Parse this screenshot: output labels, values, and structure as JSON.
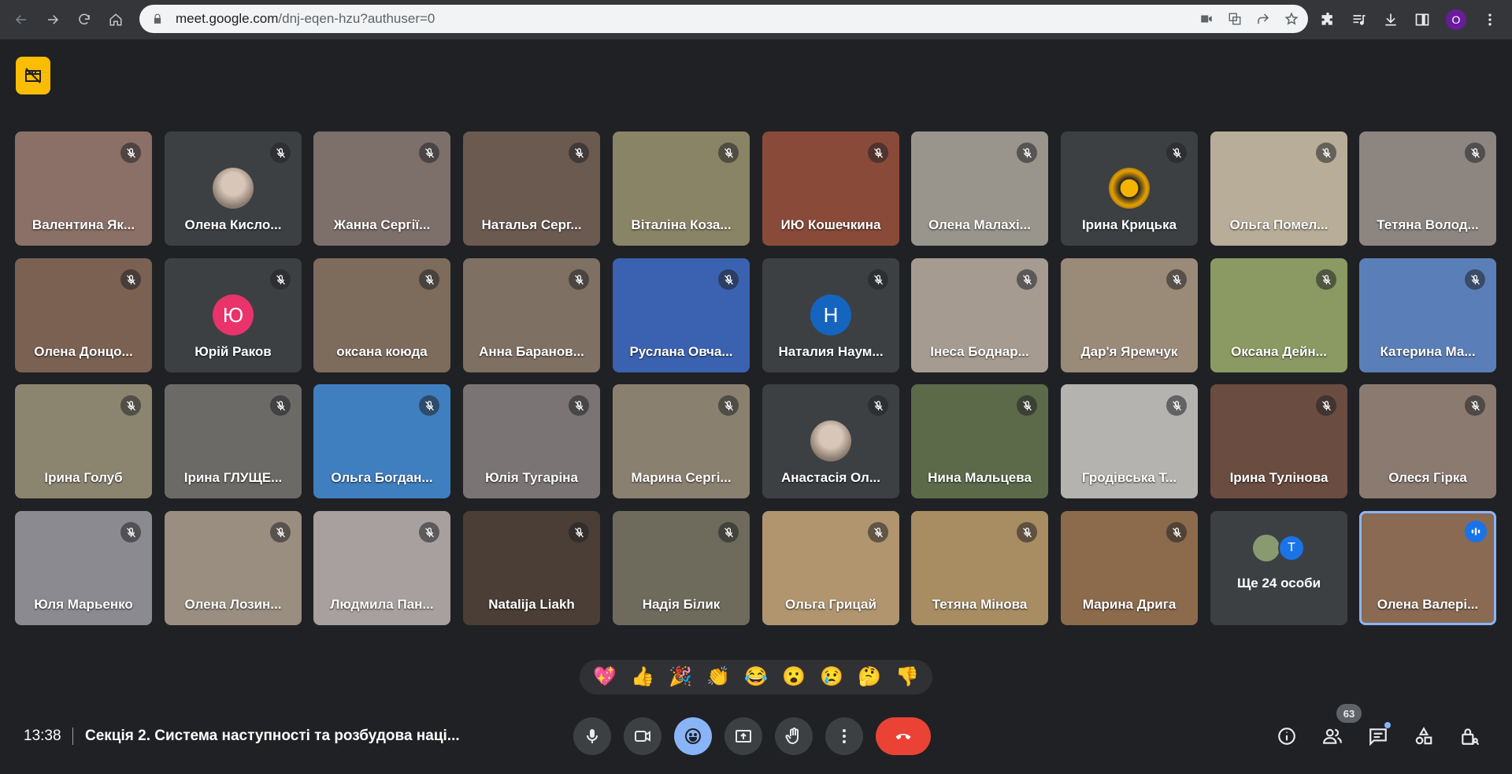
{
  "browser": {
    "url_host": "meet.google.com",
    "url_path": "/dnj-eqen-hzu?authuser=0",
    "profile_initial": "O"
  },
  "meeting": {
    "time": "13:38",
    "title": "Секція 2. Система наступності та розбудова наці..."
  },
  "participants": [
    {
      "name": "Валентина Як...",
      "bg": "#8a7066"
    },
    {
      "name": "Олена Кисло...",
      "bg": "#3c4043",
      "avatar": "photo"
    },
    {
      "name": "Жанна Сергії...",
      "bg": "#7d6f6a"
    },
    {
      "name": "Наталья Серг...",
      "bg": "#6b5a50"
    },
    {
      "name": "Віталіна Коза...",
      "bg": "#8a8466"
    },
    {
      "name": "ИЮ Кошечкина",
      "bg": "#8a4a3a"
    },
    {
      "name": "Олена Малахі...",
      "bg": "#9a958c"
    },
    {
      "name": "Ірина Крицька",
      "bg": "#3c4043",
      "avatar": "flower"
    },
    {
      "name": "Ольга Помел...",
      "bg": "#b8ad98"
    },
    {
      "name": "Тетяна Волод...",
      "bg": "#8c8580"
    },
    {
      "name": "Олена Донцо...",
      "bg": "#7a6152"
    },
    {
      "name": "Юрій Раков",
      "bg": "#3c4043",
      "avatar_letter": "Ю",
      "avatar_color": "#e8336b"
    },
    {
      "name": "оксана коюда",
      "bg": "#7d6b5c"
    },
    {
      "name": "Анна Баранов...",
      "bg": "#7e7062"
    },
    {
      "name": "Руслана Овча...",
      "bg": "#3a62b0"
    },
    {
      "name": "Наталия Наум...",
      "bg": "#3c4043",
      "avatar_letter": "Н",
      "avatar_color": "#1565c0"
    },
    {
      "name": "Інеса Боднар...",
      "bg": "#a59b90"
    },
    {
      "name": "Дар'я Яремчук",
      "bg": "#9a8a78"
    },
    {
      "name": "Оксана Дейн...",
      "bg": "#8a9a62"
    },
    {
      "name": "Катерина Ма...",
      "bg": "#5a7fb8"
    },
    {
      "name": "Ірина Голуб",
      "bg": "#8b8570"
    },
    {
      "name": "Ірина ГЛУЩЕ...",
      "bg": "#6c6a66"
    },
    {
      "name": "Ольга Богдан...",
      "bg": "#3f7fc0"
    },
    {
      "name": "Юлія Тугаріна",
      "bg": "#7a7474"
    },
    {
      "name": "Марина Сергі...",
      "bg": "#8a8070"
    },
    {
      "name": "Анастасія Ол...",
      "bg": "#3c4043",
      "avatar": "photo"
    },
    {
      "name": "Нина Мальцева",
      "bg": "#5c6a4a"
    },
    {
      "name": "Гродівська Т...",
      "bg": "#b5b3b0"
    },
    {
      "name": "Ірина Тулінова",
      "bg": "#6a4c40"
    },
    {
      "name": "Олеся Гірка",
      "bg": "#8a7a70"
    },
    {
      "name": "Юля Марьенко",
      "bg": "#8a8a90"
    },
    {
      "name": "Олена Лозин...",
      "bg": "#9a8e80"
    },
    {
      "name": "Людмила Пан...",
      "bg": "#a7a09e"
    },
    {
      "name": "Natalija Liakh",
      "bg": "#4a3e36"
    },
    {
      "name": "Надія Білик",
      "bg": "#6e6a5c"
    },
    {
      "name": "Ольга Грицай",
      "bg": "#b0956e"
    },
    {
      "name": "Тетяна Мінова",
      "bg": "#a88c62"
    },
    {
      "name": "Марина Дрига",
      "bg": "#8c6a4c"
    }
  ],
  "more_tile": {
    "text": "Ще 24 особи",
    "initial": "T"
  },
  "self_tile": {
    "name": "Олена Валері..."
  },
  "reactions": [
    "💖",
    "👍",
    "🎉",
    "👏",
    "😂",
    "😮",
    "😢",
    "🤔",
    "👎"
  ],
  "people_count": "63",
  "colors": {
    "end_call": "#ea4335",
    "accent": "#8ab4f8",
    "badge": "#fbbc04"
  }
}
